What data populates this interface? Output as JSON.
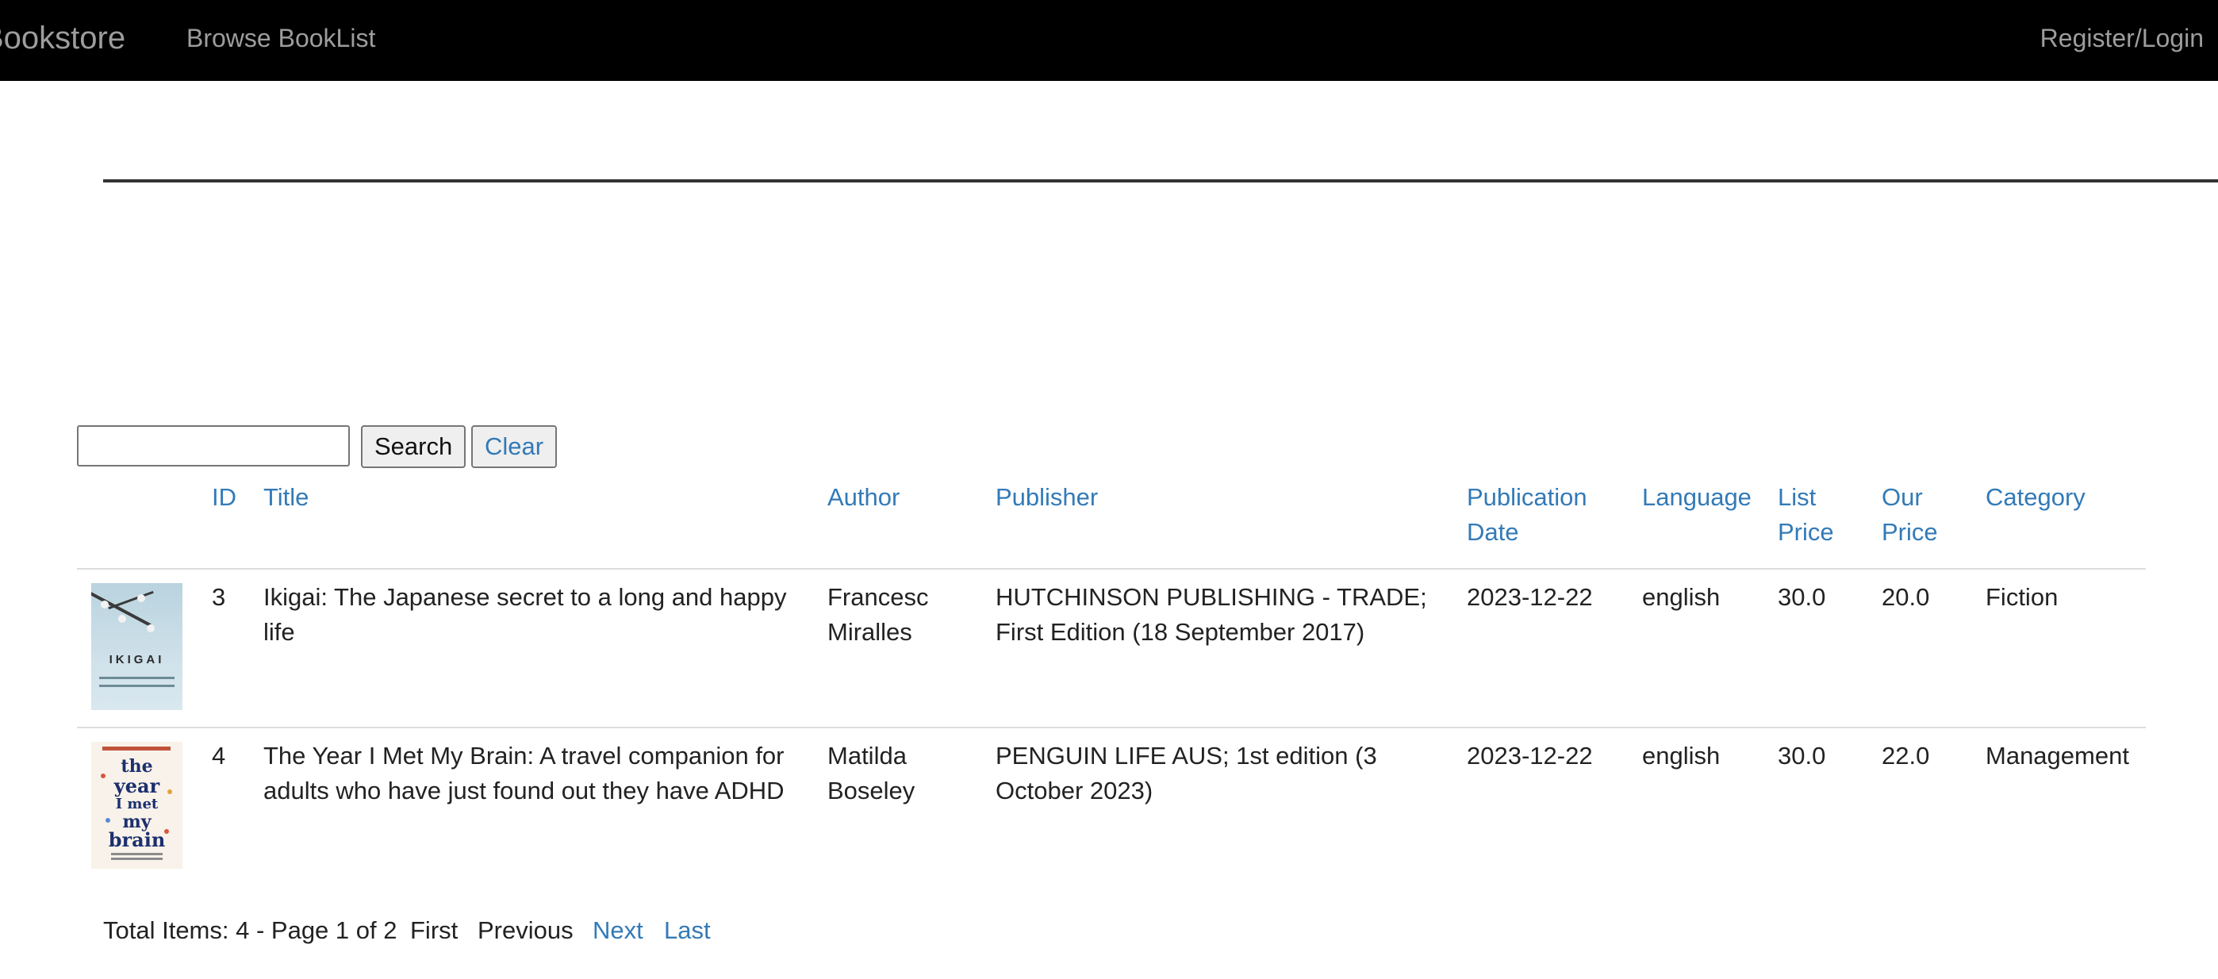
{
  "nav": {
    "brand": "Bookstore",
    "browse": "Browse BookList",
    "login": "Register/Login"
  },
  "search": {
    "value": "",
    "placeholder": "",
    "search_label": "Search",
    "clear_label": "Clear"
  },
  "table": {
    "headers": {
      "id": "ID",
      "title": "Title",
      "author": "Author",
      "publisher": "Publisher",
      "publication_date": "Publication Date",
      "language": "Language",
      "list_price": "List Price",
      "our_price": "Our Price",
      "category": "Category"
    },
    "rows": [
      {
        "id": "3",
        "title": "Ikigai: The Japanese secret to a long and happy life",
        "author": "Francesc Miralles",
        "publisher": "HUTCHINSON PUBLISHING - TRADE; First Edition (18 September 2017)",
        "publication_date": "2023-12-22",
        "language": "english",
        "list_price": "30.0",
        "our_price": "20.0",
        "category": "Fiction",
        "cover_text": "IKIGAI"
      },
      {
        "id": "4",
        "title": "The Year I Met My Brain: A travel companion for adults who have just found out they have ADHD",
        "author": "Matilda Boseley",
        "publisher": "PENGUIN LIFE AUS; 1st edition (3 October 2023)",
        "publication_date": "2023-12-22",
        "language": "english",
        "list_price": "30.0",
        "our_price": "22.0",
        "category": "Management",
        "cover_text": "the year I met my brain"
      }
    ]
  },
  "pager": {
    "total": "Total Items: 4 - Page 1 of 2",
    "first": "First",
    "previous": "Previous",
    "next": "Next",
    "last": "Last"
  },
  "colors": {
    "navbar": "#000000",
    "nav_text": "#9d9d9d",
    "link": "#337ab7"
  }
}
